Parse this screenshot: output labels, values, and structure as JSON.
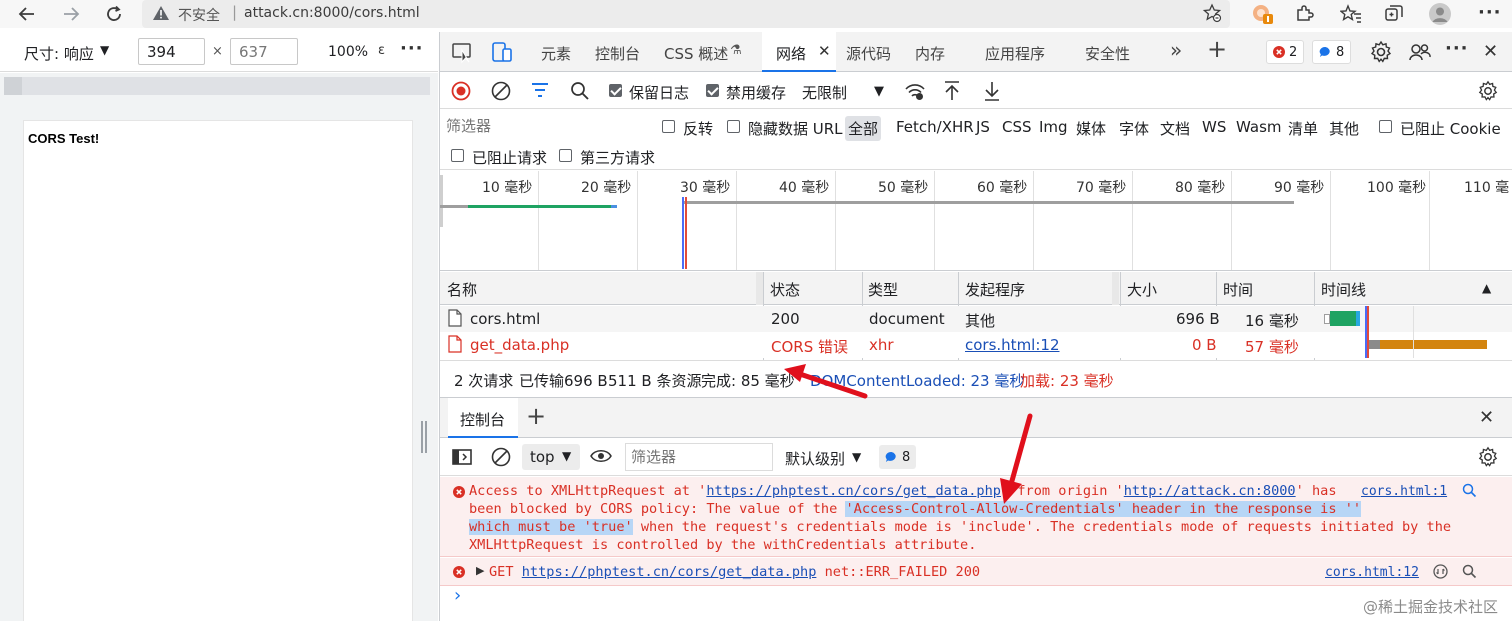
{
  "browser": {
    "insecure_label": "不安全",
    "separator": "|",
    "url": "attack.cn:8000/cors.html"
  },
  "device": {
    "size_label": "尺寸: 响应",
    "width": "394",
    "height": "637",
    "x": "×",
    "zoom": "100%",
    "zoom_caret": "ɛ",
    "more": "⋮"
  },
  "page": {
    "heading": "CORS Test!"
  },
  "devtools": {
    "tabs": [
      "元素",
      "控制台",
      "CSS 概述",
      "网络",
      "源代码",
      "内存",
      "应用程序",
      "安全性"
    ],
    "more_tabs": "»",
    "error_count": "2",
    "message_count": "8"
  },
  "network_toolbar": {
    "preserve_log": "保留日志",
    "disable_cache": "禁用缓存",
    "throttle": "无限制"
  },
  "filter": {
    "placeholder": "筛选器",
    "invert": "反转",
    "hide_data_url": "隐藏数据 URL",
    "types": [
      "全部",
      "Fetch/XHR",
      "JS",
      "CSS",
      "Img",
      "媒体",
      "字体",
      "文档",
      "WS",
      "Wasm",
      "清单",
      "其他"
    ],
    "blocked_cookies": "已阻止 Cookie",
    "blocked_requests": "已阻止请求",
    "third_party": "第三方请求"
  },
  "timeline": {
    "ticks": [
      "10 毫秒",
      "20 毫秒",
      "30 毫秒",
      "40 毫秒",
      "50 毫秒",
      "60 毫秒",
      "70 毫秒",
      "80 毫秒",
      "90 毫秒",
      "100 毫秒",
      "110 毫"
    ]
  },
  "table": {
    "headers": [
      "名称",
      "状态",
      "类型",
      "发起程序",
      "大小",
      "时间",
      "时间线"
    ],
    "rows": [
      {
        "name": "cors.html",
        "status": "200",
        "type": "document",
        "initiator": "其他",
        "size": "696 B",
        "time": "16 毫秒"
      },
      {
        "name": "get_data.php",
        "status": "CORS 错误",
        "type": "xhr",
        "initiator": "cors.html:12",
        "size": "0 B",
        "time": "57 毫秒"
      }
    ]
  },
  "summary": {
    "requests": "2 次请求",
    "transferred": "已传输696 B",
    "resources": "511 B 条资源",
    "finish": "完成: 85 毫秒",
    "dcl": "DOMContentLoaded: 23 毫秒",
    "load": "加载: 23 毫秒"
  },
  "drawer": {
    "console_tab": "控制台",
    "context": "top",
    "filter_placeholder": "筛选器",
    "level": "默认级别",
    "msg_count": "8"
  },
  "console": {
    "error1": {
      "p1": "Access to XMLHttpRequest at '",
      "url": "https://phptest.cn/cors/get_data.php",
      "p2": "' from origin '",
      "origin": "http://attack.cn:8000",
      "p3": "' has",
      "line2a": "been blocked by CORS policy: The value of the ",
      "line2hl": "'Access-Control-Allow-Credentials' header in the response is ''",
      "line3hl": "which must be 'true'",
      "line3b": " when the request's credentials mode is 'include'. The credentials mode of requests initiated by the",
      "line4": "XMLHttpRequest is controlled by the withCredentials attribute.",
      "source": "cors.html:1"
    },
    "error2": {
      "method": "GET",
      "url": "https://phptest.cn/cors/get_data.php",
      "status": "net::ERR_FAILED 200",
      "source": "cors.html:12"
    },
    "prompt": "›"
  },
  "watermark": "@稀土掘金技术社区",
  "colors": {
    "accent": "#1a73e8",
    "error": "#d93025",
    "link": "#1a4fb6",
    "arrow": "#e0101c"
  }
}
